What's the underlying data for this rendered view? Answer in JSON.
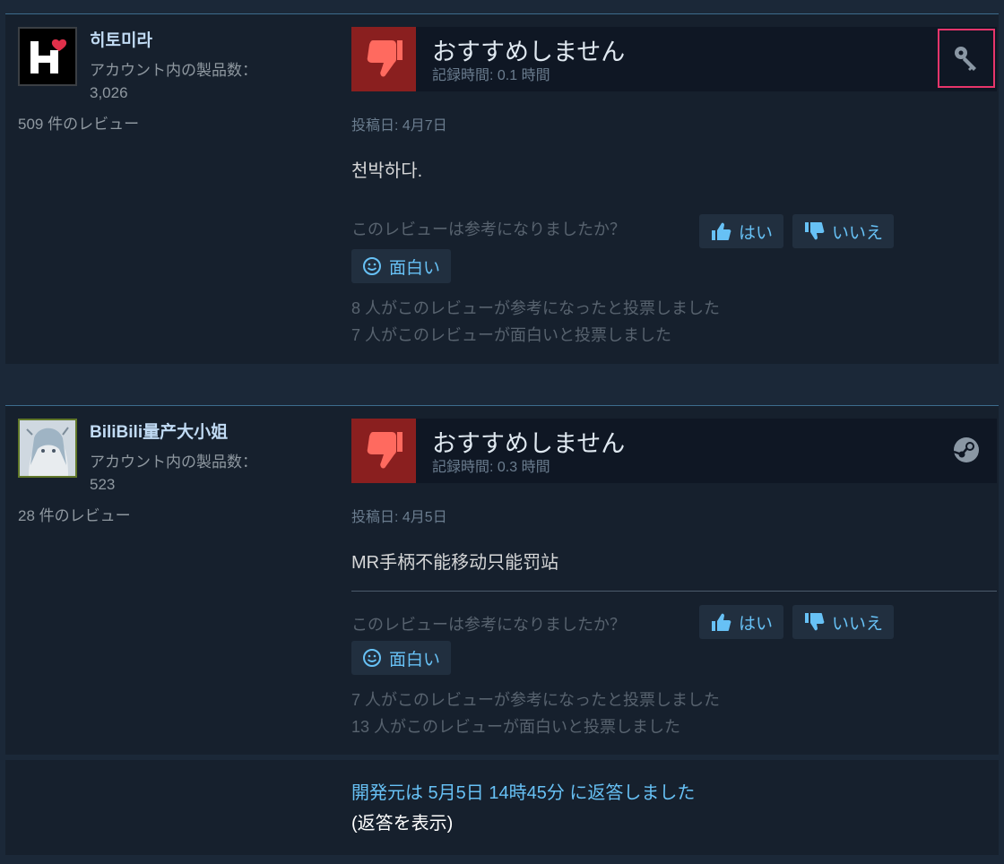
{
  "reviews": [
    {
      "author_name": "히토미라",
      "products_label": "アカウント内の製品数：",
      "products_count": "3,026",
      "review_count": "509 件のレビュー",
      "verdict": "おすすめしません",
      "playtime": "記録時間: 0.1 時間",
      "posted": "投稿日: 4月7日",
      "content": "천박하다.",
      "helpful_question": "このレビューは参考になりましたか？",
      "yes_label": "はい",
      "no_label": "いいえ",
      "funny_label": "面白い",
      "helpful_votes": "8 人がこのレビューが参考になったと投票しました",
      "funny_votes": "7 人がこのレビューが面白いと投票しました",
      "source_icon": "key-icon"
    },
    {
      "author_name": "BiliBili量产大小姐",
      "products_label": "アカウント内の製品数：",
      "products_count": "523",
      "review_count": "28 件のレビュー",
      "verdict": "おすすめしません",
      "playtime": "記録時間: 0.3 時間",
      "posted": "投稿日: 4月5日",
      "content": "MR手柄不能移动只能罚站",
      "helpful_question": "このレビューは参考になりましたか？",
      "yes_label": "はい",
      "no_label": "いいえ",
      "funny_label": "面白い",
      "helpful_votes": "7 人がこのレビューが参考になったと投票しました",
      "funny_votes": "13 人がこのレビューが面白いと投票しました",
      "source_icon": "steam-icon"
    }
  ],
  "developer_response": {
    "line": "開発元は 5月5日 14時45分 に返答しました",
    "show": "(返答を表示)"
  },
  "colors": {
    "background": "#1b2838",
    "panel": "#16202d",
    "link": "#67c1f5",
    "thumb_down_bg": "#8a1f1f",
    "highlight": "#e8356b"
  }
}
